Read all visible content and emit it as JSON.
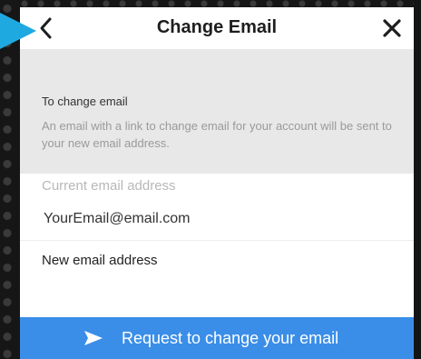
{
  "header": {
    "title": "Change Email",
    "back_icon": "chevron-left-icon",
    "close_icon": "close-icon"
  },
  "info": {
    "title": "To change email",
    "text": "An email with a link to change email for your account will be sent to your new email address."
  },
  "form": {
    "current_label": "Current email address",
    "current_value": "YourEmail@email.com",
    "new_label": "New email address"
  },
  "submit": {
    "label": "Request to change your email",
    "icon": "send-icon"
  },
  "colors": {
    "accent": "#3a8ee8",
    "cursor": "#1fa9e1",
    "info_bg": "#e8e8e8"
  }
}
